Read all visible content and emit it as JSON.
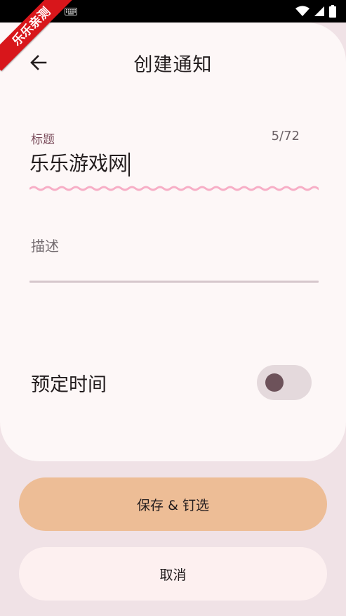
{
  "watermark": {
    "label": "乐乐亲测"
  },
  "header": {
    "title": "创建通知"
  },
  "title_field": {
    "label": "标题",
    "value": "乐乐游戏网",
    "counter": "5/72"
  },
  "description_field": {
    "placeholder": "描述"
  },
  "schedule": {
    "label": "预定时间",
    "enabled": false
  },
  "actions": {
    "save_label": "保存 & 钉选",
    "cancel_label": "取消"
  },
  "colors": {
    "accent": "#edbd96",
    "label": "#7b4c5b",
    "spellcheck": "#f7aec6",
    "switch_thumb": "#6d525a"
  }
}
